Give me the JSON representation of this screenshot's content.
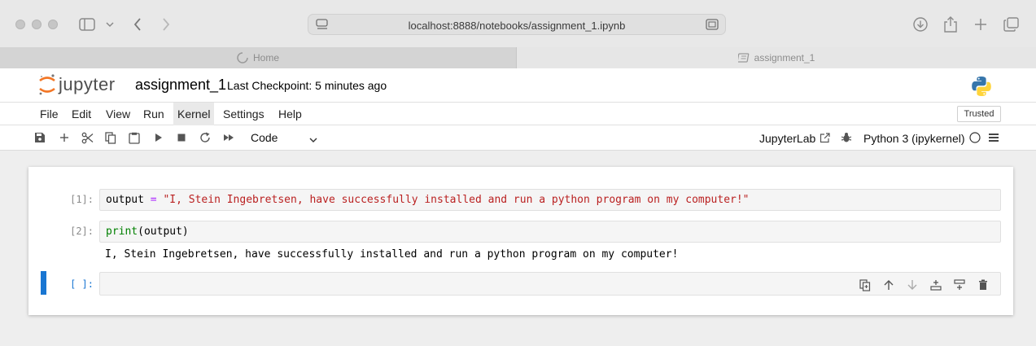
{
  "browser": {
    "url": "localhost:8888/notebooks/assignment_1.ipynb",
    "tabs": [
      {
        "label": "Home",
        "icon": "loading-icon"
      },
      {
        "label": "assignment_1",
        "icon": "book-icon"
      }
    ]
  },
  "header": {
    "logo_text": "jupyter",
    "notebook_title": "assignment_1",
    "checkpoint": "Last Checkpoint: 5 minutes ago"
  },
  "menu": {
    "items": [
      "File",
      "Edit",
      "View",
      "Run",
      "Kernel",
      "Settings",
      "Help"
    ],
    "active": "Kernel",
    "trusted_label": "Trusted"
  },
  "toolbar": {
    "cell_type": "Code",
    "jupyterlab_label": "JupyterLab",
    "kernel_name": "Python 3 (ipykernel)"
  },
  "cells": [
    {
      "prompt": "[1]:",
      "code_tokens": [
        "output",
        " = ",
        "\"I, Stein Ingebretsen, have successfully installed and run a python program on my computer!\""
      ]
    },
    {
      "prompt": "[2]:",
      "code_tokens": [
        "print",
        "(output)"
      ],
      "output": "I, Stein Ingebretsen, have successfully installed and run a python program on my computer!"
    },
    {
      "prompt": "[ ]:",
      "code_tokens": []
    }
  ],
  "colors": {
    "accent": "#1976d2",
    "keyword": "#008000",
    "operator": "#aa22ff",
    "string": "#ba2121",
    "jupyter_orange": "#f37726"
  }
}
